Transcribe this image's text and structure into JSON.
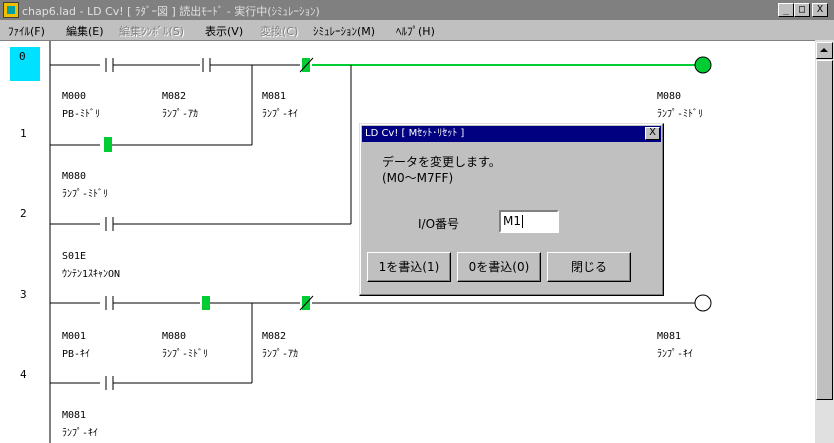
{
  "window": {
    "title": "chap6.lad - LD Cv! [ ﾗﾀﾞｰ図 ] 読出ﾓｰﾄﾞ - 実行中(ｼﾐｭﾚｰｼｮﾝ)",
    "minimize": "_",
    "maximize": "□",
    "close": "X"
  },
  "menu": {
    "file": "ﾌｧｲﾙ(F)",
    "edit": "編集(E)",
    "edit_symbol": "編集ｼﾝﾎﾞﾙ(S)",
    "view": "表示(V)",
    "convert": "変換(C)",
    "simulation": "ｼﾐｭﾚｰｼｮﾝ(M)",
    "help": "ﾍﾙﾌﾟ(H)"
  },
  "ladder": {
    "row_numbers": [
      "0",
      "1",
      "2",
      "3",
      "4"
    ],
    "contacts": [
      {
        "address": "M000",
        "comment": "PB-ﾐﾄﾞﾘ"
      },
      {
        "address": "M082",
        "comment": "ﾗﾝﾌﾟ-ｱｶ"
      },
      {
        "address": "M081",
        "comment": "ﾗﾝﾌﾟ-ｷｲ"
      },
      {
        "address": "M080",
        "comment": "ﾗﾝﾌﾟ-ﾐﾄﾞﾘ"
      },
      {
        "address": "M080",
        "comment": "ﾗﾝﾌﾟ-ﾐﾄﾞﾘ"
      },
      {
        "address": "S01E",
        "comment": "ｳﾝﾃﾝ1ｽｷｬﾝON"
      },
      {
        "address": "M001",
        "comment": "PB-ｷｲ"
      },
      {
        "address": "M080",
        "comment": "ﾗﾝﾌﾟ-ﾐﾄﾞﾘ"
      },
      {
        "address": "M082",
        "comment": "ﾗﾝﾌﾟ-ｱｶ"
      },
      {
        "address": "M081",
        "comment": "ﾗﾝﾌﾟ-ｷｲ"
      },
      {
        "address": "M081",
        "comment": "ﾗﾝﾌﾟ-ｷｲ"
      }
    ],
    "energized_color": "#00cc33"
  },
  "dialog": {
    "title": "LD Cv! [ Mｾｯﾄ･ﾘｾｯﾄ ]",
    "close": "X",
    "message_line1": "データを変更します。",
    "message_line2": "(M0～M7FF)",
    "io_label": "I/O番号",
    "io_value": "M1",
    "btn_write1": "1を書込(1)",
    "btn_write0": "0を書込(0)",
    "btn_close": "閉じる"
  }
}
